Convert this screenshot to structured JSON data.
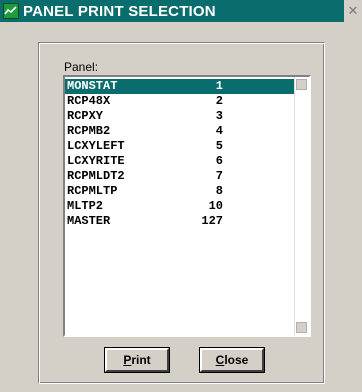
{
  "window": {
    "title": "PANEL PRINT SELECTION",
    "close_glyph": "✕"
  },
  "panel": {
    "label": "Panel:",
    "items": [
      {
        "name": "MONSTAT",
        "value": "1",
        "selected": true
      },
      {
        "name": "RCP48X",
        "value": "2",
        "selected": false
      },
      {
        "name": "RCPXY",
        "value": "3",
        "selected": false
      },
      {
        "name": "RCPMB2",
        "value": "4",
        "selected": false
      },
      {
        "name": "LCXYLEFT",
        "value": "5",
        "selected": false
      },
      {
        "name": "LCXYRITE",
        "value": "6",
        "selected": false
      },
      {
        "name": "RCPMLDT2",
        "value": "7",
        "selected": false
      },
      {
        "name": "RCPMLTP",
        "value": "8",
        "selected": false
      },
      {
        "name": "MLTP2",
        "value": "10",
        "selected": false
      },
      {
        "name": "MASTER",
        "value": "127",
        "selected": false
      }
    ]
  },
  "buttons": {
    "print_mnemonic": "P",
    "print_rest": "rint",
    "close_mnemonic": "C",
    "close_rest": "lose"
  },
  "colors": {
    "titlebar": "#0a6d6d",
    "selection": "#0a6d6d",
    "face": "#d4d0c8"
  }
}
